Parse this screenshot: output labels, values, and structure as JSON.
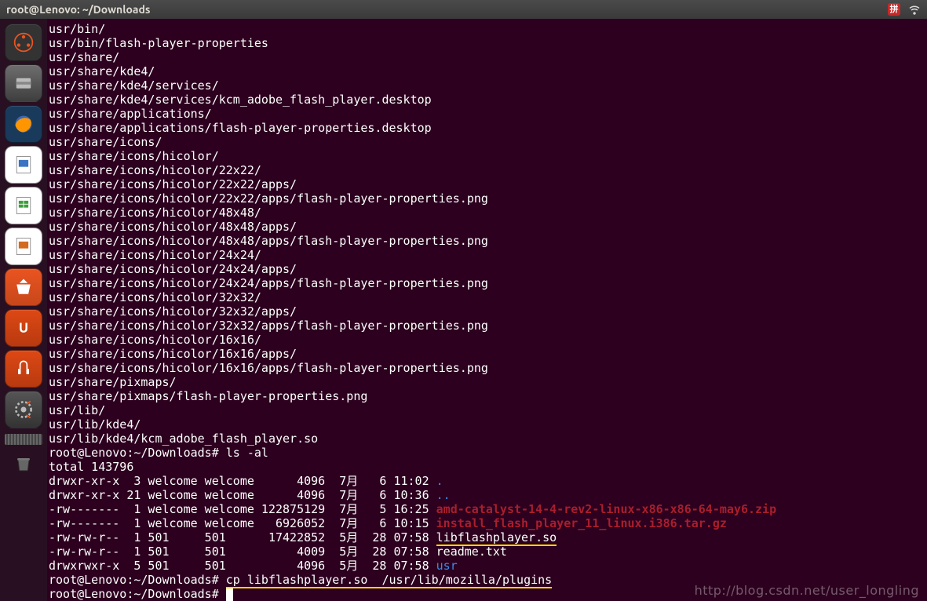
{
  "titlebar": {
    "title": "root@Lenovo: ~/Downloads"
  },
  "tray": {
    "pinyin": "拼"
  },
  "terminal": {
    "lines": [
      "usr/bin/",
      "usr/bin/flash-player-properties",
      "usr/share/",
      "usr/share/kde4/",
      "usr/share/kde4/services/",
      "usr/share/kde4/services/kcm_adobe_flash_player.desktop",
      "usr/share/applications/",
      "usr/share/applications/flash-player-properties.desktop",
      "usr/share/icons/",
      "usr/share/icons/hicolor/",
      "usr/share/icons/hicolor/22x22/",
      "usr/share/icons/hicolor/22x22/apps/",
      "usr/share/icons/hicolor/22x22/apps/flash-player-properties.png",
      "usr/share/icons/hicolor/48x48/",
      "usr/share/icons/hicolor/48x48/apps/",
      "usr/share/icons/hicolor/48x48/apps/flash-player-properties.png",
      "usr/share/icons/hicolor/24x24/",
      "usr/share/icons/hicolor/24x24/apps/",
      "usr/share/icons/hicolor/24x24/apps/flash-player-properties.png",
      "usr/share/icons/hicolor/32x32/",
      "usr/share/icons/hicolor/32x32/apps/",
      "usr/share/icons/hicolor/32x32/apps/flash-player-properties.png",
      "usr/share/icons/hicolor/16x16/",
      "usr/share/icons/hicolor/16x16/apps/",
      "usr/share/icons/hicolor/16x16/apps/flash-player-properties.png",
      "usr/share/pixmaps/",
      "usr/share/pixmaps/flash-player-properties.png",
      "usr/lib/",
      "usr/lib/kde4/",
      "usr/lib/kde4/kcm_adobe_flash_player.so"
    ],
    "prompt_path": "root@Lenovo:~/Downloads#",
    "cmd1": "ls -al",
    "total": "total 143796",
    "rows": [
      {
        "perm": "drwxr-xr-x",
        "ln": "3",
        "o": "welcome",
        "g": "welcome",
        "sz": "4096",
        "dt": "7月   6 11:02",
        "name": ".",
        "cls": "blue"
      },
      {
        "perm": "drwxr-xr-x",
        "ln": "21",
        "o": "welcome",
        "g": "welcome",
        "sz": "4096",
        "dt": "7月   6 10:36",
        "name": "..",
        "cls": "blue"
      },
      {
        "perm": "-rw-------",
        "ln": "1",
        "o": "welcome",
        "g": "welcome",
        "sz": "122875129",
        "dt": "7月   5 16:25",
        "name": "amd-catalyst-14-4-rev2-linux-x86-x86-64-may6.zip",
        "cls": "red"
      },
      {
        "perm": "-rw-------",
        "ln": "1",
        "o": "welcome",
        "g": "welcome",
        "sz": "6926052",
        "dt": "7月   6 10:15",
        "name": "install_flash_player_11_linux.i386.tar.gz",
        "cls": "red"
      },
      {
        "perm": "-rw-rw-r--",
        "ln": "1",
        "o": "501",
        "g": "501",
        "sz": "17422852",
        "dt": "5月  28 07:58",
        "name": "libflashplayer.so",
        "cls": ""
      },
      {
        "perm": "-rw-rw-r--",
        "ln": "1",
        "o": "501",
        "g": "501",
        "sz": "4009",
        "dt": "5月  28 07:58",
        "name": "readme.txt",
        "cls": ""
      },
      {
        "perm": "drwxrwxr-x",
        "ln": "5",
        "o": "501",
        "g": "501",
        "sz": "4096",
        "dt": "5月  28 07:58",
        "name": "usr",
        "cls": "blue"
      }
    ],
    "cmd2_a": "cp libflashplayer.so  /usr/lib/mozilla/plugins",
    "underline_row_index": 4
  },
  "watermark": "http://blog.csdn.net/user_longling"
}
